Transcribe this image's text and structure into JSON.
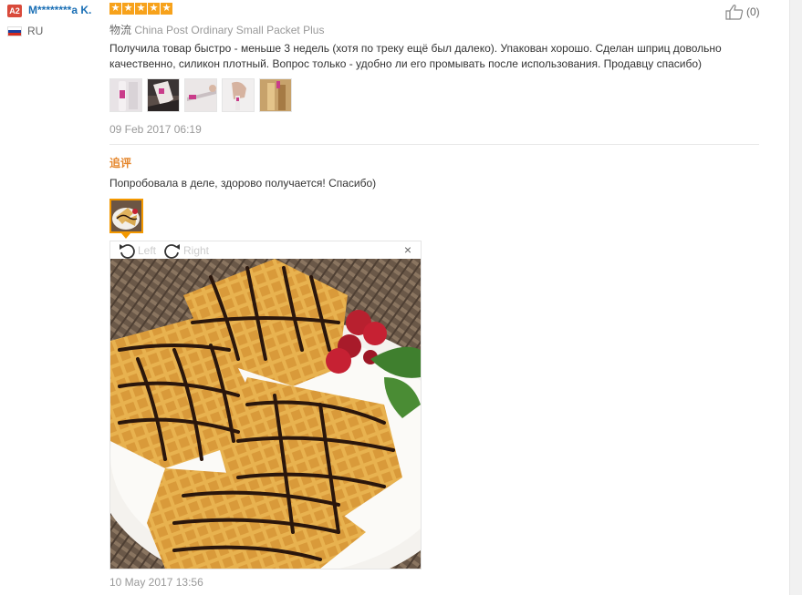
{
  "user": {
    "level": "A2",
    "name": "M********a K.",
    "country_code": "RU",
    "flag_colors": [
      "#ffffff",
      "#1c3f9e",
      "#d52b1e"
    ]
  },
  "rating": {
    "stars": 5,
    "max": 5,
    "star_glyph": "★",
    "color": "#f7a21b"
  },
  "helpful": {
    "count_text": "(0)",
    "icon": "thumbs-up-icon"
  },
  "shipping": {
    "label": "物流",
    "method": "China Post Ordinary Small Packet Plus"
  },
  "review": {
    "text": "Получила товар быстро - меньше 3 недель (хотя по треку ещё был далеко). Упакован хорошо. Сделан шприц довольно качественно, силикон плотный. Вопрос только - удобно ли его промывать после использования. Продавцу спасибо)",
    "date": "09 Feb 2017 06:19",
    "photo_count": 5
  },
  "followup": {
    "label": "追评",
    "text": "Попробовала в деле, здорово получается! Спасибо)",
    "date": "10 May 2017 13:56"
  },
  "viewer": {
    "rotate_left_label": "Left",
    "rotate_right_label": "Right",
    "close_glyph": "×"
  },
  "colors": {
    "accent_orange": "#f39800",
    "link_blue": "#1a6fb5",
    "followup_orange": "#e5862b"
  }
}
